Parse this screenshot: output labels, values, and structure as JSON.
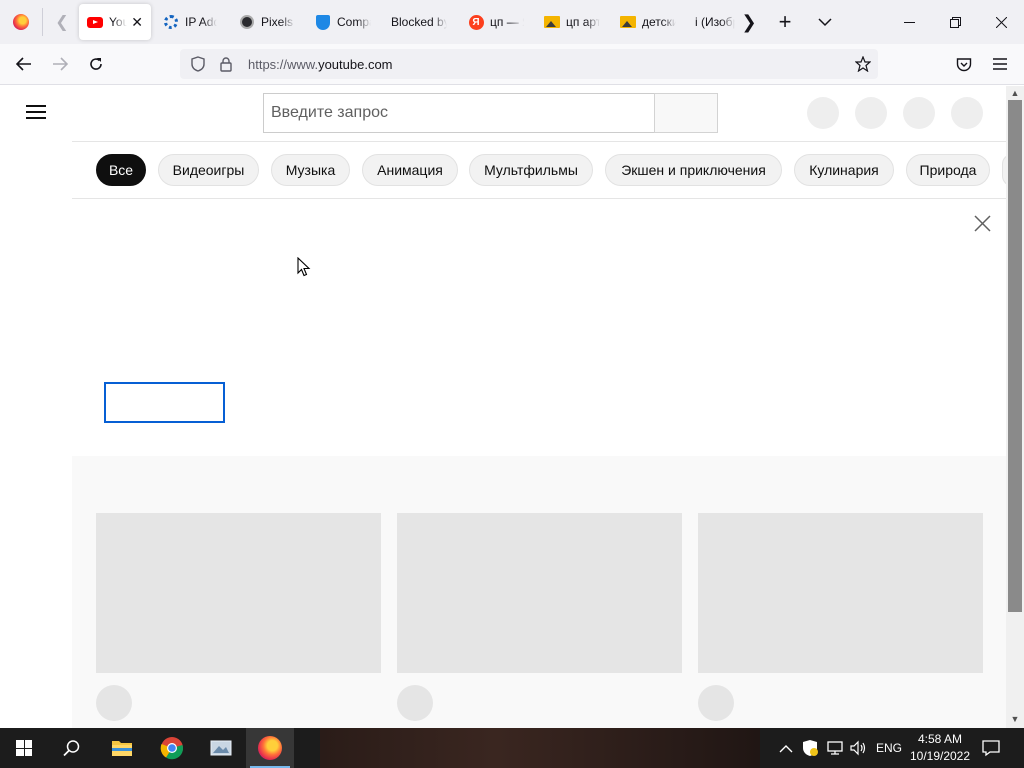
{
  "browser": {
    "tabs": [
      {
        "title": "YouTube",
        "favicon": "youtube-icon",
        "active": true
      },
      {
        "title": "IP Address",
        "favicon": "gear-icon"
      },
      {
        "title": "Pixels",
        "favicon": "pixels-icon"
      },
      {
        "title": "Compass",
        "favicon": "shield-icon"
      },
      {
        "title": "Blocked by",
        "favicon": ""
      },
      {
        "title": "цп — Яндекс",
        "favicon": "yandex-icon"
      },
      {
        "title": "цп арт",
        "favicon": "image-icon"
      },
      {
        "title": "детские",
        "favicon": "image-icon"
      },
      {
        "title": "i (Изобр",
        "favicon": ""
      }
    ],
    "url_scheme": "https://www.",
    "url_host": "youtube.com"
  },
  "youtube": {
    "search_placeholder": "Введите запрос",
    "chips": [
      "Все",
      "Видеоигры",
      "Музыка",
      "Анимация",
      "Мультфильмы",
      "Экшен и приключения",
      "Кулинария",
      "Природа"
    ],
    "active_chip": "Все"
  },
  "taskbar": {
    "apps": [
      "start-icon",
      "search-icon",
      "file-explorer-icon",
      "chrome-icon",
      "app-icon",
      "firefox-icon"
    ],
    "language": "ENG",
    "time": "4:58 AM",
    "date": "10/19/2022"
  },
  "colors": {
    "accent": "#065fd4",
    "chip_active": "#0f0f0f",
    "youtube_red": "#ff0000"
  }
}
